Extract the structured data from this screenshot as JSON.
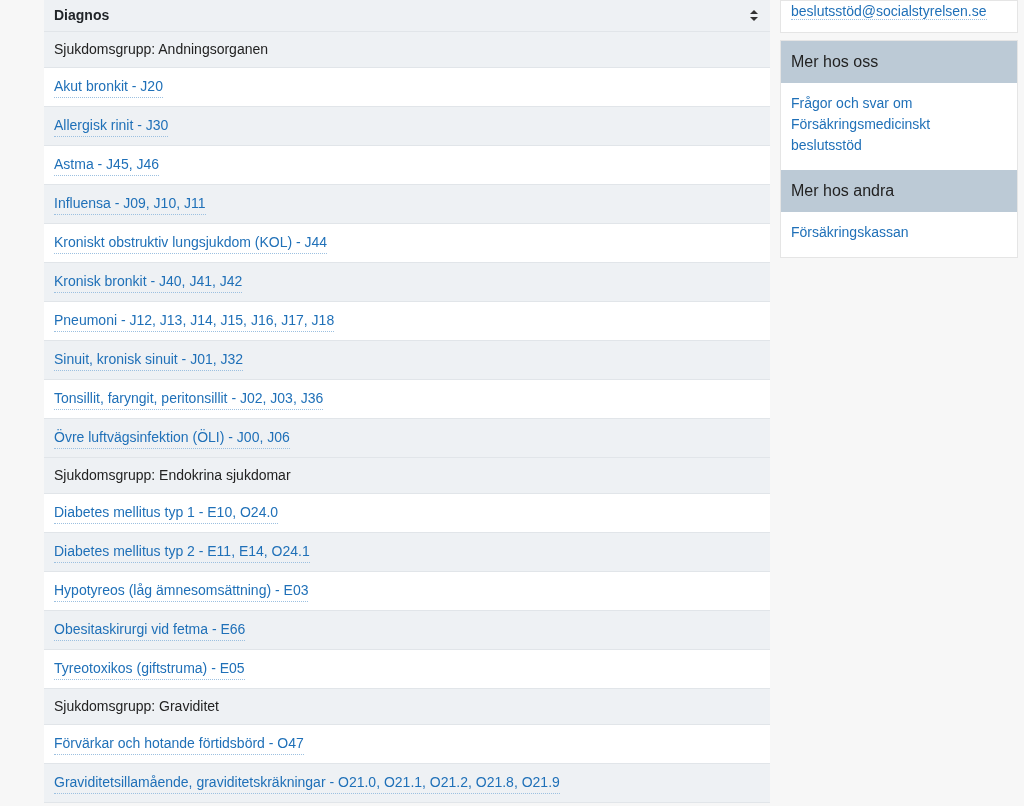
{
  "table": {
    "heading": "Diagnos",
    "groups": [
      {
        "title": "Sjukdomsgrupp: Andningsorganen",
        "items": [
          "Akut bronkit - J20",
          "Allergisk rinit - J30",
          "Astma - J45, J46",
          "Influensa - J09, J10, J11",
          "Kroniskt obstruktiv lungsjukdom (KOL) - J44",
          "Kronisk bronkit - J40, J41, J42",
          "Pneumoni - J12, J13, J14, J15, J16, J17, J18",
          "Sinuit, kronisk sinuit - J01, J32",
          "Tonsillit, faryngit, peritonsillit - J02, J03, J36",
          "Övre luftvägsinfektion (ÖLI) - J00, J06"
        ]
      },
      {
        "title": "Sjukdomsgrupp: Endokrina sjukdomar",
        "items": [
          "Diabetes mellitus typ 1 - E10, O24.0",
          "Diabetes mellitus typ 2 - E11, E14, O24.1",
          "Hypotyreos (låg ämnesomsättning) - E03",
          "Obesitaskirurgi vid fetma - E66",
          "Tyreotoxikos (giftstruma) - E05"
        ]
      },
      {
        "title": "Sjukdomsgrupp: Graviditet",
        "items": [
          "Förvärkar och hotande förtidsbörd - O47",
          "Graviditetsillamående, graviditetskräkningar - O21.0, O21.1, O21.2, O21.8, O21.9"
        ]
      }
    ]
  },
  "sidebar": {
    "contact_link": "beslutsstöd@socialstyrelsen.se",
    "sections": [
      {
        "title": "Mer hos oss",
        "links": [
          "Frågor och svar om Försäkringsmedicinskt beslutsstöd"
        ]
      },
      {
        "title": "Mer hos andra",
        "links": [
          "Försäkringskassan"
        ]
      }
    ]
  }
}
